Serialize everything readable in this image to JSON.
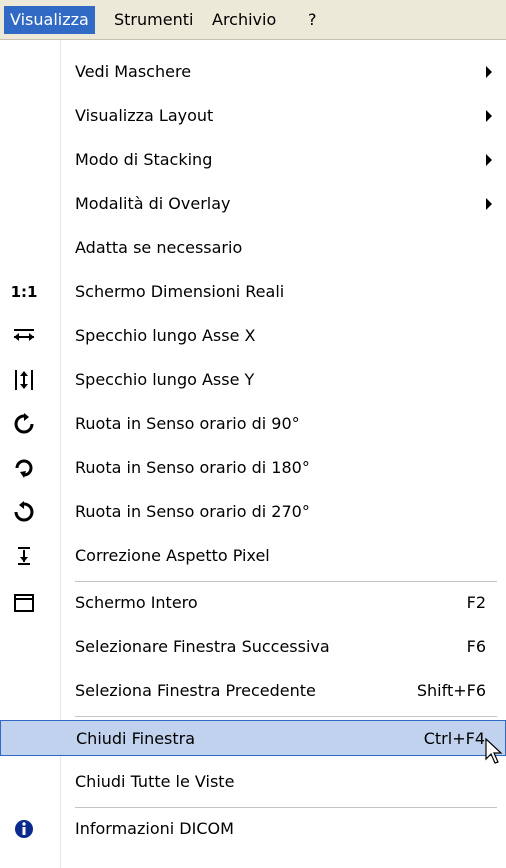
{
  "menubar": {
    "items": [
      {
        "label": "Visualizza"
      },
      {
        "label": "Strumenti"
      },
      {
        "label": "Archivio"
      },
      {
        "label": "?"
      }
    ]
  },
  "menu": {
    "items": [
      {
        "label": "Vedi Maschere",
        "submenu": true
      },
      {
        "label": "Visualizza Layout",
        "submenu": true
      },
      {
        "label": "Modo di Stacking",
        "submenu": true
      },
      {
        "label": "Modalità di Overlay",
        "submenu": true
      },
      {
        "label": "Adatta se necessario"
      },
      {
        "label": "Schermo Dimensioni Reali",
        "icon_text": "1:1"
      },
      {
        "label": "Specchio lungo Asse X",
        "icon": "mirror-horizontal-icon"
      },
      {
        "label": "Specchio lungo Asse Y",
        "icon": "mirror-vertical-icon"
      },
      {
        "label": "Ruota in Senso orario di 90°",
        "icon": "rotate-90-icon"
      },
      {
        "label": "Ruota in Senso orario di 180°",
        "icon": "rotate-180-icon"
      },
      {
        "label": "Ruota in Senso orario di 270°",
        "icon": "rotate-270-icon"
      },
      {
        "label": "Correzione Aspetto Pixel",
        "icon": "pixel-aspect-icon"
      },
      {
        "label": "Schermo Intero",
        "shortcut": "F2",
        "icon": "fullscreen-icon"
      },
      {
        "label": "Selezionare Finestra Successiva",
        "shortcut": "F6"
      },
      {
        "label": "Seleziona Finestra Precedente",
        "shortcut": "Shift+F6"
      },
      {
        "label": "Chiudi Finestra",
        "shortcut": "Ctrl+F4"
      },
      {
        "label": "Chiudi Tutte le Viste"
      },
      {
        "label": "Informazioni DICOM",
        "icon": "info-icon"
      }
    ]
  },
  "colors": {
    "menubar_bg": "#ece9d8",
    "active_menu": "#316ac5",
    "highlight_bg": "#c1d2ee",
    "highlight_border": "#316ac5"
  }
}
